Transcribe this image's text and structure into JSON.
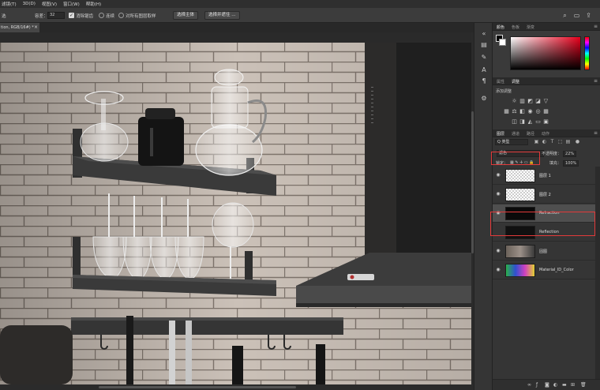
{
  "menu": [
    "滤镜(T)",
    "3D(D)",
    "视图(V)",
    "窗口(W)",
    "帮助(H)"
  ],
  "options": {
    "mode_partial": "选",
    "tolerance_label": "容差：",
    "tolerance_value": "32",
    "antialias_label": "消除锯齿",
    "contiguous_label": "连续",
    "sample_all_label": "对所有图层取样",
    "select_subject": "选择主体",
    "select_mask": "选择并遮住 ..."
  },
  "document_tab": {
    "label": "tion, RGB/16#) *",
    "close": "×"
  },
  "panels": {
    "color_tabs": [
      "颜色",
      "色板",
      "渐变"
    ],
    "adj_tabs": [
      "属性",
      "调整"
    ],
    "adj_label": "添加调整",
    "layers_tabs": [
      "图层",
      "通道",
      "路径",
      "动作"
    ],
    "kind_label": "Q 类型",
    "blend_mode": "滤色",
    "opacity_label": "不透明度：",
    "opacity_value": "22%",
    "lock_label": "锁定：",
    "fill_label": "填充：",
    "fill_value": "100%"
  },
  "layers": [
    {
      "name": "图层 1",
      "thumb": "checker",
      "selected": false
    },
    {
      "name": "图层 2",
      "thumb": "checker",
      "selected": false
    },
    {
      "name": "Refraction",
      "thumb": "dark",
      "selected": true
    },
    {
      "name": "Reflection",
      "thumb": "dark2",
      "selected": false
    },
    {
      "name": "固图",
      "thumb": "render",
      "selected": false
    },
    {
      "name": "Material_ID_Color",
      "thumb": "idcolor",
      "selected": false
    }
  ],
  "colors": {
    "highlight": "#e23a3a",
    "wall": "#c9bfb6",
    "grout": "#7d736b",
    "shelf": "#3a3a3a"
  }
}
